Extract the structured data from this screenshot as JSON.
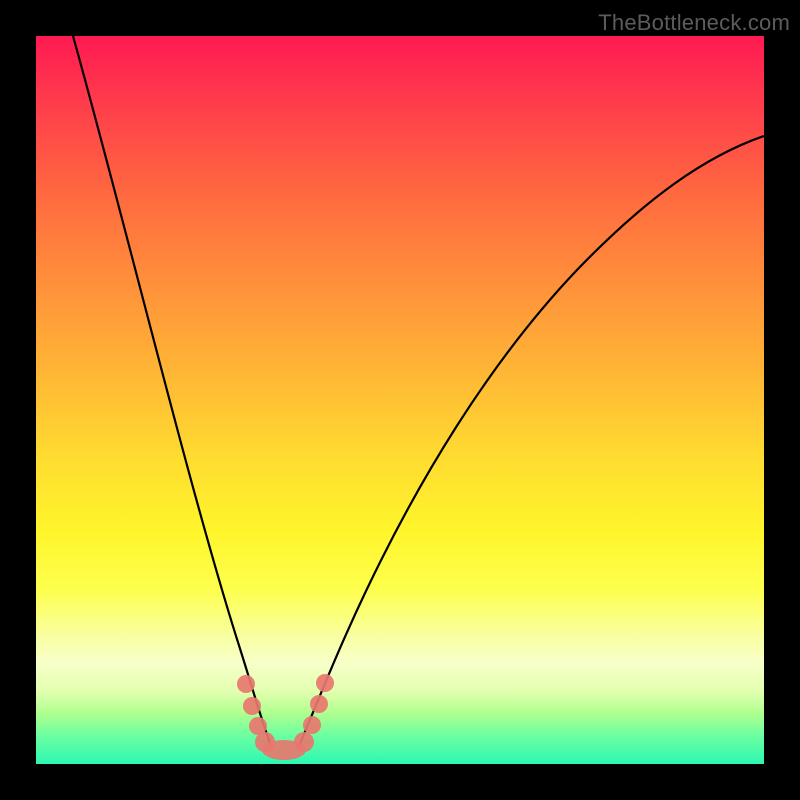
{
  "watermark": "TheBottleneck.com",
  "chart_data": {
    "type": "line",
    "title": "",
    "xlabel": "",
    "ylabel": "",
    "xlim": [
      0,
      100
    ],
    "ylim": [
      0,
      100
    ],
    "min_x": 32,
    "series": [
      {
        "name": "bottleneck-curve",
        "x": [
          5,
          10,
          15,
          20,
          25,
          28,
          30,
          32,
          34,
          36,
          40,
          45,
          50,
          55,
          60,
          65,
          70,
          75,
          80,
          85,
          90,
          95,
          100
        ],
        "y": [
          100,
          82,
          63,
          43,
          23,
          10,
          3,
          0,
          2,
          7,
          17,
          29,
          39,
          48,
          55,
          61,
          67,
          71,
          75,
          79,
          82,
          84,
          86
        ]
      }
    ],
    "optimal_band": {
      "x_start": 28,
      "x_end": 37
    },
    "valley_markers": {
      "x": [
        27.5,
        28.5,
        29.5,
        31.0,
        33.0,
        34.5,
        35.5,
        36.5
      ],
      "y": [
        14,
        8,
        3,
        1,
        1,
        4,
        8,
        14
      ]
    },
    "gradient_stops": [
      {
        "pos": 0,
        "color": "#ff1a52"
      },
      {
        "pos": 50,
        "color": "#ffd633"
      },
      {
        "pos": 100,
        "color": "#2cf7b2"
      }
    ]
  }
}
